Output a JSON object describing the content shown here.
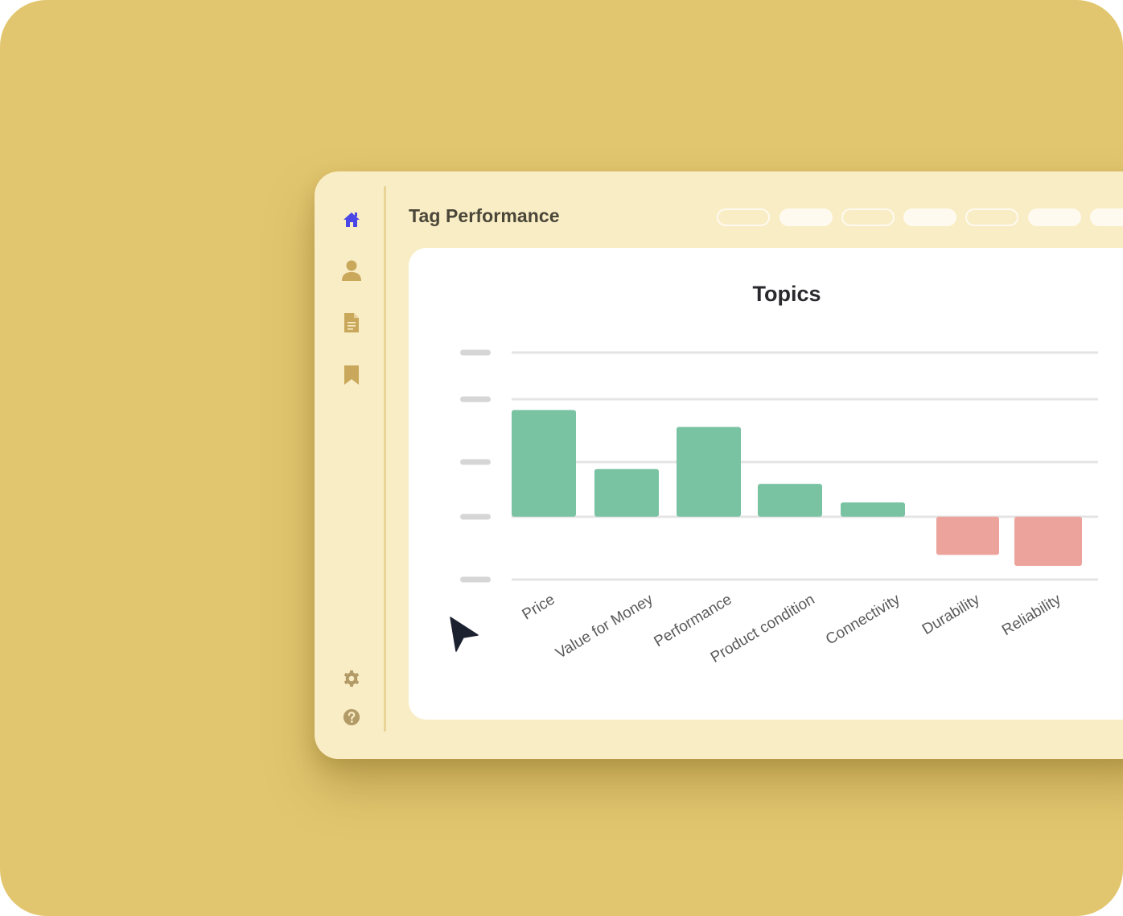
{
  "app": {
    "title": "Tag Performance"
  },
  "sidebar": {
    "items": [
      {
        "icon": "home-icon",
        "name": "home",
        "active": true
      },
      {
        "icon": "user-icon",
        "name": "profile",
        "active": false
      },
      {
        "icon": "document-icon",
        "name": "documents",
        "active": false
      },
      {
        "icon": "bookmark-icon",
        "name": "bookmarks",
        "active": false
      }
    ],
    "bottom_items": [
      {
        "icon": "gear-icon",
        "name": "settings"
      },
      {
        "icon": "help-icon",
        "name": "help"
      }
    ]
  },
  "header": {
    "filter_pills": [
      {
        "style": "outline"
      },
      {
        "style": "solid"
      },
      {
        "style": "outline"
      },
      {
        "style": "solid"
      },
      {
        "style": "outline"
      },
      {
        "style": "solid"
      },
      {
        "style": "solid"
      }
    ]
  },
  "colors": {
    "background": "#e2c66f",
    "window": "#f9edc6",
    "card": "#ffffff",
    "accent": "#4b46e6",
    "icon": "#c9a85c",
    "positive": "#79c2a2",
    "negative": "#eba39b",
    "gridline": "#e4e4e4",
    "tick_placeholder": "#d6d6d6"
  },
  "chart_data": {
    "type": "bar",
    "title": "Topics",
    "categories": [
      "Price",
      "Value for Money",
      "Performance",
      "Product condition",
      "Connectivity",
      "Durability",
      "Reliability"
    ],
    "values": [
      1.95,
      0.87,
      1.64,
      0.6,
      0.26,
      -0.7,
      -0.9
    ],
    "ylim": [
      -1.15,
      3.0
    ],
    "grid": true,
    "ytick_labels_visible": false,
    "legend": "none"
  }
}
